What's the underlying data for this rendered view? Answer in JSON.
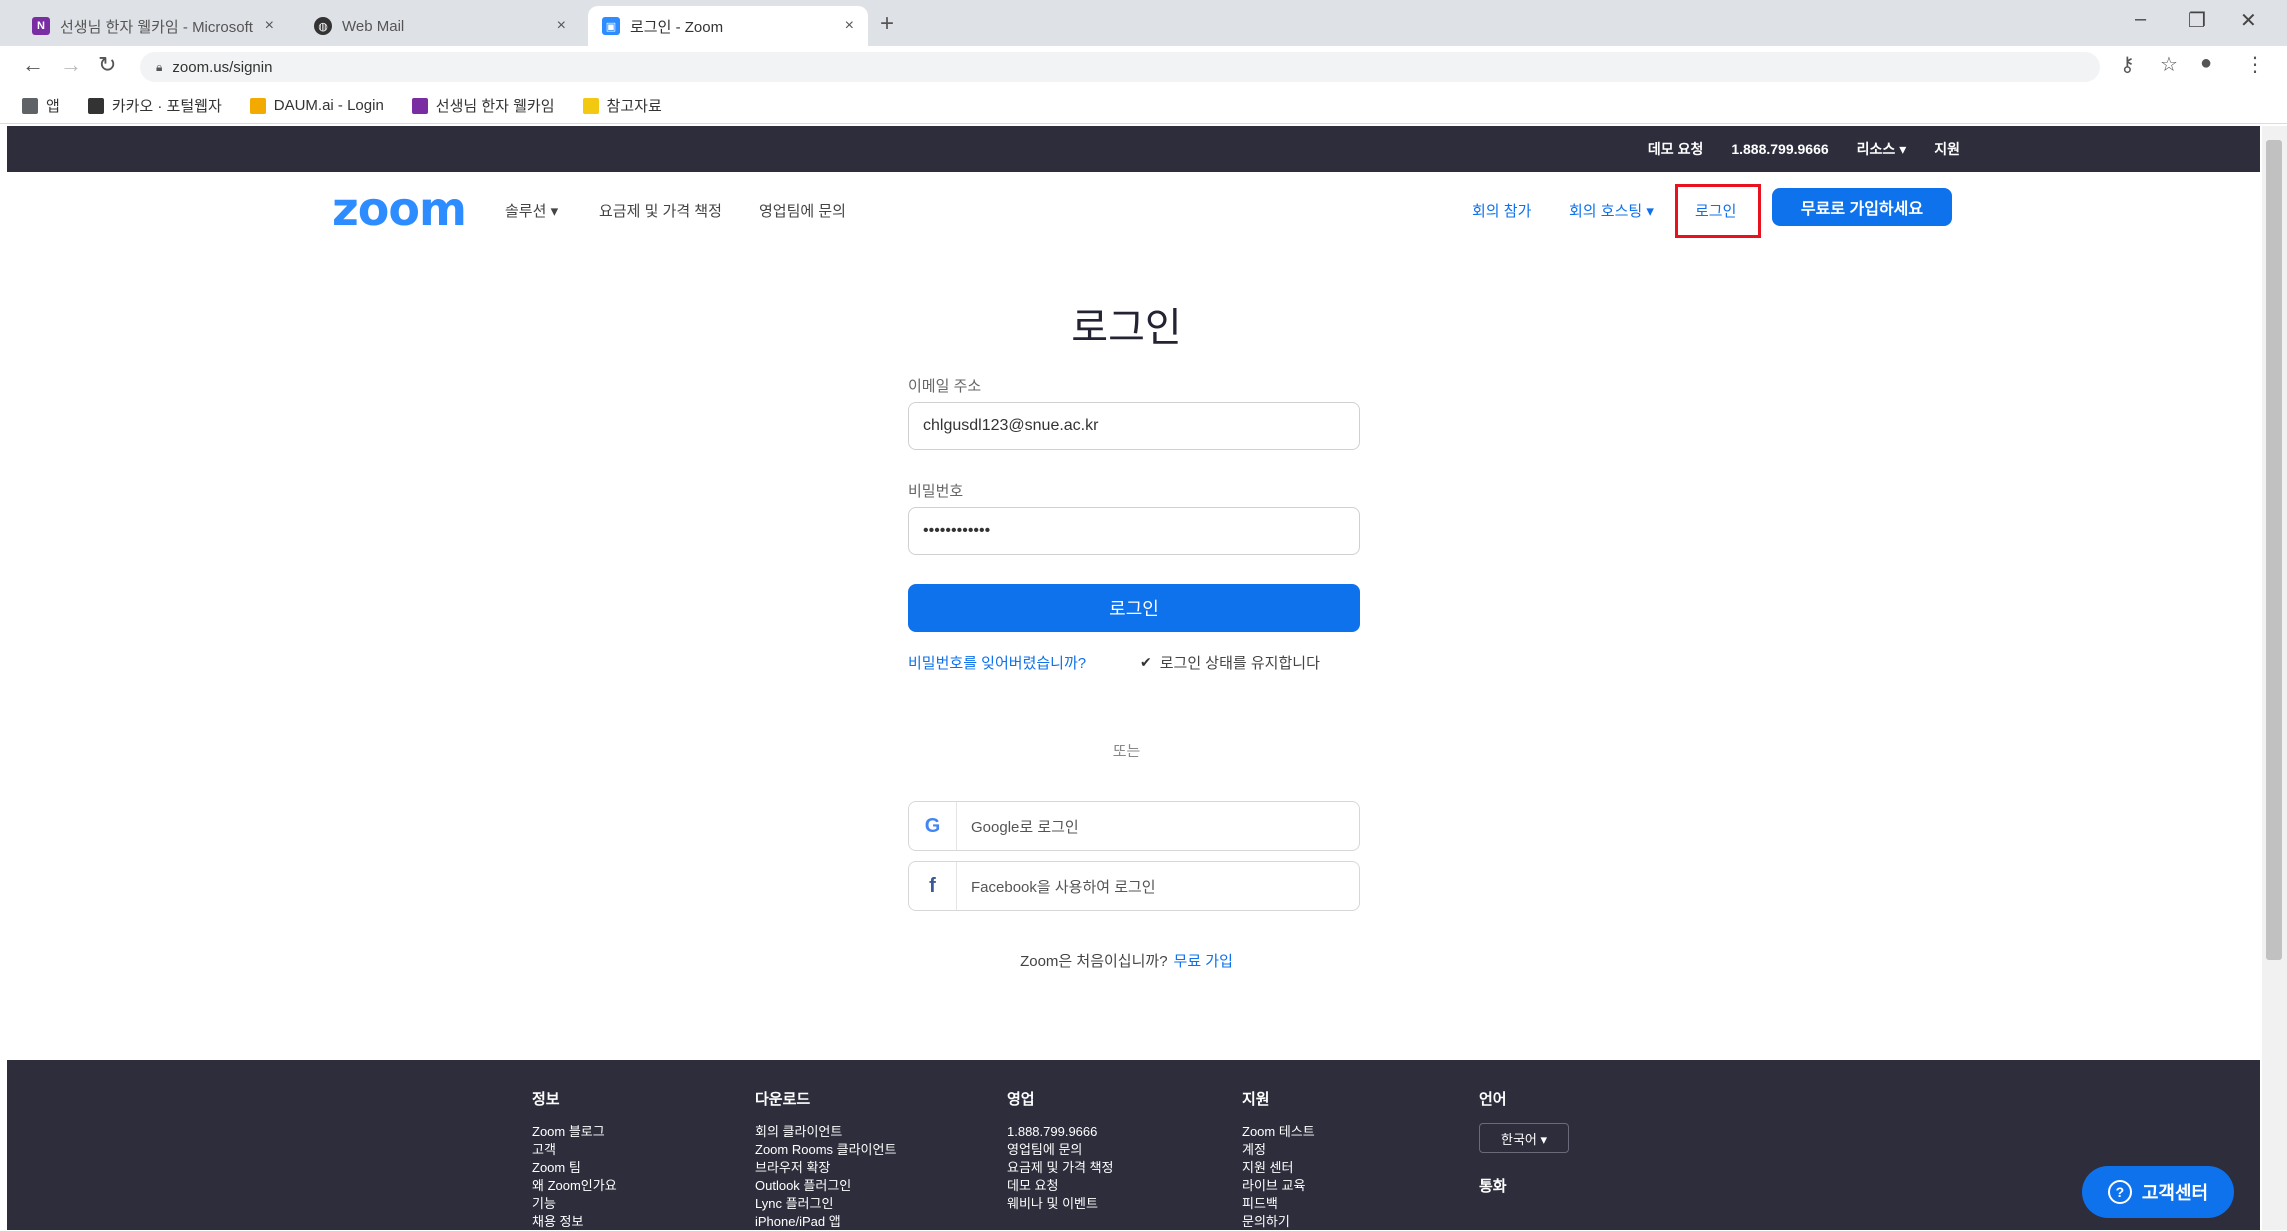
{
  "browser": {
    "tabs": [
      {
        "label": "선생님 한자 웰카임 - Microsoft",
        "close": "×",
        "color": "#7a2da3"
      },
      {
        "label": "Web Mail",
        "close": "×",
        "color": "#333333"
      },
      {
        "label": "로그인 - Zoom",
        "close": "×",
        "color": "#2d8cff"
      }
    ],
    "new_tab": "+",
    "window_controls": {
      "minimize": "–",
      "restore": "❐",
      "close": "✕"
    },
    "url": "zoom.us/signin",
    "bookmarks": [
      {
        "label": "앱",
        "color": "#5f6368"
      },
      {
        "label": "카카오 · 포털웹자",
        "color": "#333333"
      },
      {
        "label": "DAUM.ai - Login",
        "color": "#f2a900"
      },
      {
        "label": "선생님 한자 웰카임",
        "color": "#7a2da3"
      },
      {
        "label": "참고자료",
        "color": "#f2c811"
      }
    ]
  },
  "topbar": {
    "items": [
      "데모 요청",
      "1.888.799.9666",
      "리소스 ▾",
      "지원"
    ]
  },
  "nav": {
    "logo": "zoom",
    "left_links": [
      "솔루션 ▾",
      "요금제 및 가격 책정",
      "영업팀에 문의"
    ],
    "right_links": [
      "회의 참가",
      "회의 호스팅 ▾",
      "로그인"
    ],
    "signup": "무료로 가입하세요"
  },
  "login": {
    "title": "로그인",
    "email_label": "이메일 주소",
    "email_value": "chlgusdl123@snue.ac.kr",
    "password_label": "비밀번호",
    "password_value": "••••••••••••",
    "button": "로그인",
    "forgot": "비밀번호를 잊어버렸습니까?",
    "stay_signed_in": "로그인 상태를 유지합니다",
    "or": "또는",
    "google": "Google로 로그인",
    "facebook": "Facebook을 사용하여 로그인",
    "new_to_zoom": "Zoom은 처음이십니까?",
    "free_signup": "무료 가입"
  },
  "footer": {
    "columns": [
      {
        "heading": "정보",
        "items": [
          "Zoom 블로그",
          "고객",
          "Zoom 팀",
          "왜 Zoom인가요",
          "기능",
          "채용 정보"
        ]
      },
      {
        "heading": "다운로드",
        "items": [
          "회의 클라이언트",
          "Zoom Rooms 클라이언트",
          "브라우저 확장",
          "Outlook 플러그인",
          "Lync 플러그인",
          "iPhone/iPad 앱"
        ]
      },
      {
        "heading": "영업",
        "items": [
          "1.888.799.9666",
          "영업팀에 문의",
          "요금제 및 가격 책정",
          "데모 요청",
          "웨비나 및 이벤트"
        ]
      },
      {
        "heading": "지원",
        "items": [
          "Zoom 테스트",
          "계정",
          "지원 센터",
          "라이브 교육",
          "피드백",
          "문의하기"
        ]
      }
    ],
    "language_heading": "언어",
    "language_value": "한국어 ▾",
    "currency_heading": "통화",
    "help": "고객센터"
  }
}
